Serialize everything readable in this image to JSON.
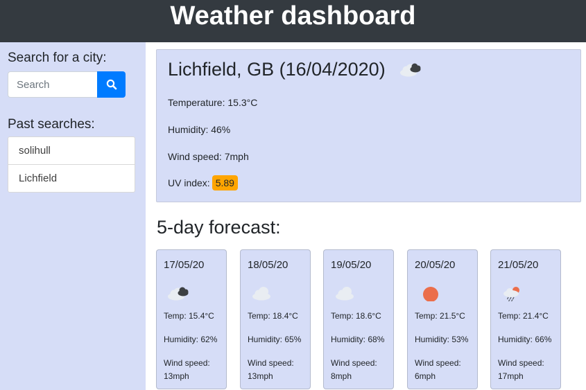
{
  "header": {
    "title": "Weather dashboard"
  },
  "sidebar": {
    "search_label": "Search for a city:",
    "search_placeholder": "Search",
    "search_value": "",
    "past_label": "Past searches:",
    "past_searches": [
      "solihull",
      "Lichfield"
    ]
  },
  "current": {
    "title": "Lichfield, GB (16/04/2020)",
    "icon": "broken-clouds-icon",
    "temperature": "Temperature: 15.3°C",
    "humidity": "Humidity: 46%",
    "wind": "Wind speed: 7mph",
    "uv_label": "UV index:",
    "uv_value": "5.89",
    "uv_color": "#ffa500"
  },
  "forecast": {
    "title": "5-day forecast:",
    "days": [
      {
        "date": "17/05/20",
        "icon": "broken-clouds-icon",
        "temp": "Temp: 15.4°C",
        "humidity": "Humidity: 62%",
        "wind_label": "Wind speed:",
        "wind_value": "13mph"
      },
      {
        "date": "18/05/20",
        "icon": "cloud-icon",
        "temp": "Temp: 18.4°C",
        "humidity": "Humidity: 65%",
        "wind_label": "Wind speed:",
        "wind_value": "13mph"
      },
      {
        "date": "19/05/20",
        "icon": "cloud-icon",
        "temp": "Temp: 18.6°C",
        "humidity": "Humidity: 68%",
        "wind_label": "Wind speed:",
        "wind_value": "8mph"
      },
      {
        "date": "20/05/20",
        "icon": "sun-icon",
        "temp": "Temp: 21.5°C",
        "humidity": "Humidity: 53%",
        "wind_label": "Wind speed:",
        "wind_value": "6mph"
      },
      {
        "date": "21/05/20",
        "icon": "rain-icon",
        "temp": "Temp: 21.4°C",
        "humidity": "Humidity: 66%",
        "wind_label": "Wind speed:",
        "wind_value": "17mph"
      }
    ]
  },
  "colors": {
    "header_bg": "#343a40",
    "panel_bg": "#d6ddf7",
    "search_button": "#007bff",
    "sun": "#eb6e4b"
  }
}
